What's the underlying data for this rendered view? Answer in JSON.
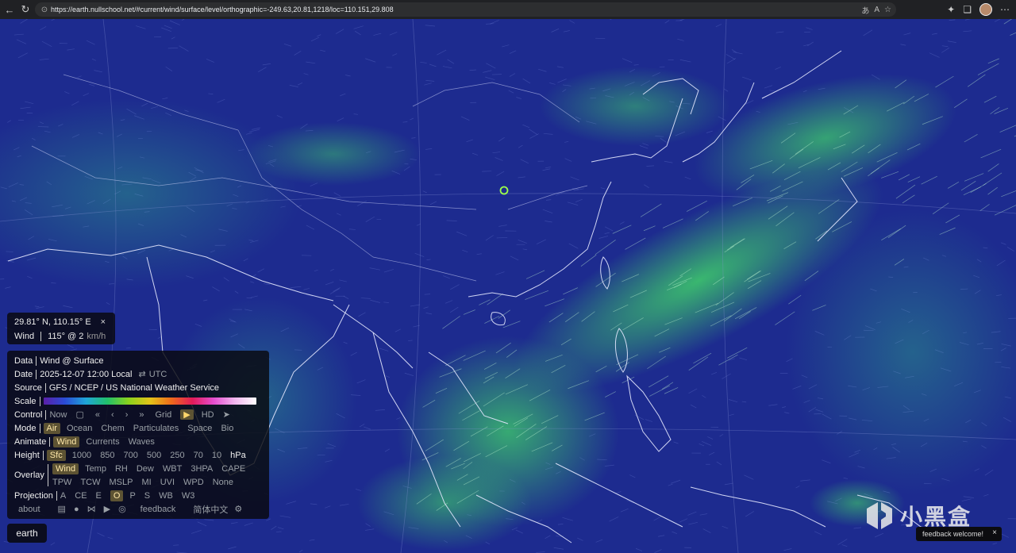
{
  "browser": {
    "url": "https://earth.nullschool.net/#current/wind/surface/level/orthographic=-249.63,20.81,1218/loc=110.151,29.808",
    "back_icon": "back-arrow-icon",
    "refresh_icon": "refresh-icon"
  },
  "location_panel": {
    "coords": "29.81° N, 110.15° E",
    "wind_label": "Wind",
    "wind_value": "115° @ 2",
    "wind_unit": "km/h",
    "close": "×"
  },
  "menu": {
    "data": {
      "label": "Data",
      "value": "Wind @ Surface"
    },
    "date": {
      "label": "Date",
      "value": "2025-12-07 12:00 Local",
      "swap": "⇄",
      "alt": "UTC"
    },
    "source": {
      "label": "Source",
      "value": "GFS / NCEP / US National Weather Service"
    },
    "scale": {
      "label": "Scale"
    },
    "control": {
      "label": "Control",
      "now": "Now",
      "grid": "Grid",
      "hd": "HD"
    },
    "mode": {
      "label": "Mode",
      "options": [
        "Air",
        "Ocean",
        "Chem",
        "Particulates",
        "Space",
        "Bio"
      ]
    },
    "animate": {
      "label": "Animate",
      "options": [
        "Wind",
        "Currents",
        "Waves"
      ]
    },
    "height": {
      "label": "Height",
      "options": [
        "Sfc",
        "1000",
        "850",
        "700",
        "500",
        "250",
        "70",
        "10"
      ],
      "unit": "hPa"
    },
    "overlay": {
      "label": "Overlay",
      "row1": [
        "Wind",
        "Temp",
        "RH",
        "Dew",
        "WBT",
        "3HPA",
        "CAPE"
      ],
      "row2": [
        "TPW",
        "TCW",
        "MSLP",
        "MI",
        "UVI",
        "WPD",
        "None"
      ]
    },
    "projection": {
      "label": "Projection",
      "options": [
        "A",
        "CE",
        "E",
        "O",
        "P",
        "S",
        "WB",
        "W3"
      ]
    },
    "footer": {
      "about": "about",
      "feedback": "feedback",
      "lang": "简体中文"
    }
  },
  "earth_label": "earth",
  "watermark": "小黑盒",
  "feedback_toast": {
    "text": "feedback welcome!",
    "close": "×"
  },
  "colors": {
    "ocean": "#1c2a8c",
    "wind_strong": "#3fd06a",
    "selected": "#5d5333",
    "marker": "#9cff4a"
  }
}
